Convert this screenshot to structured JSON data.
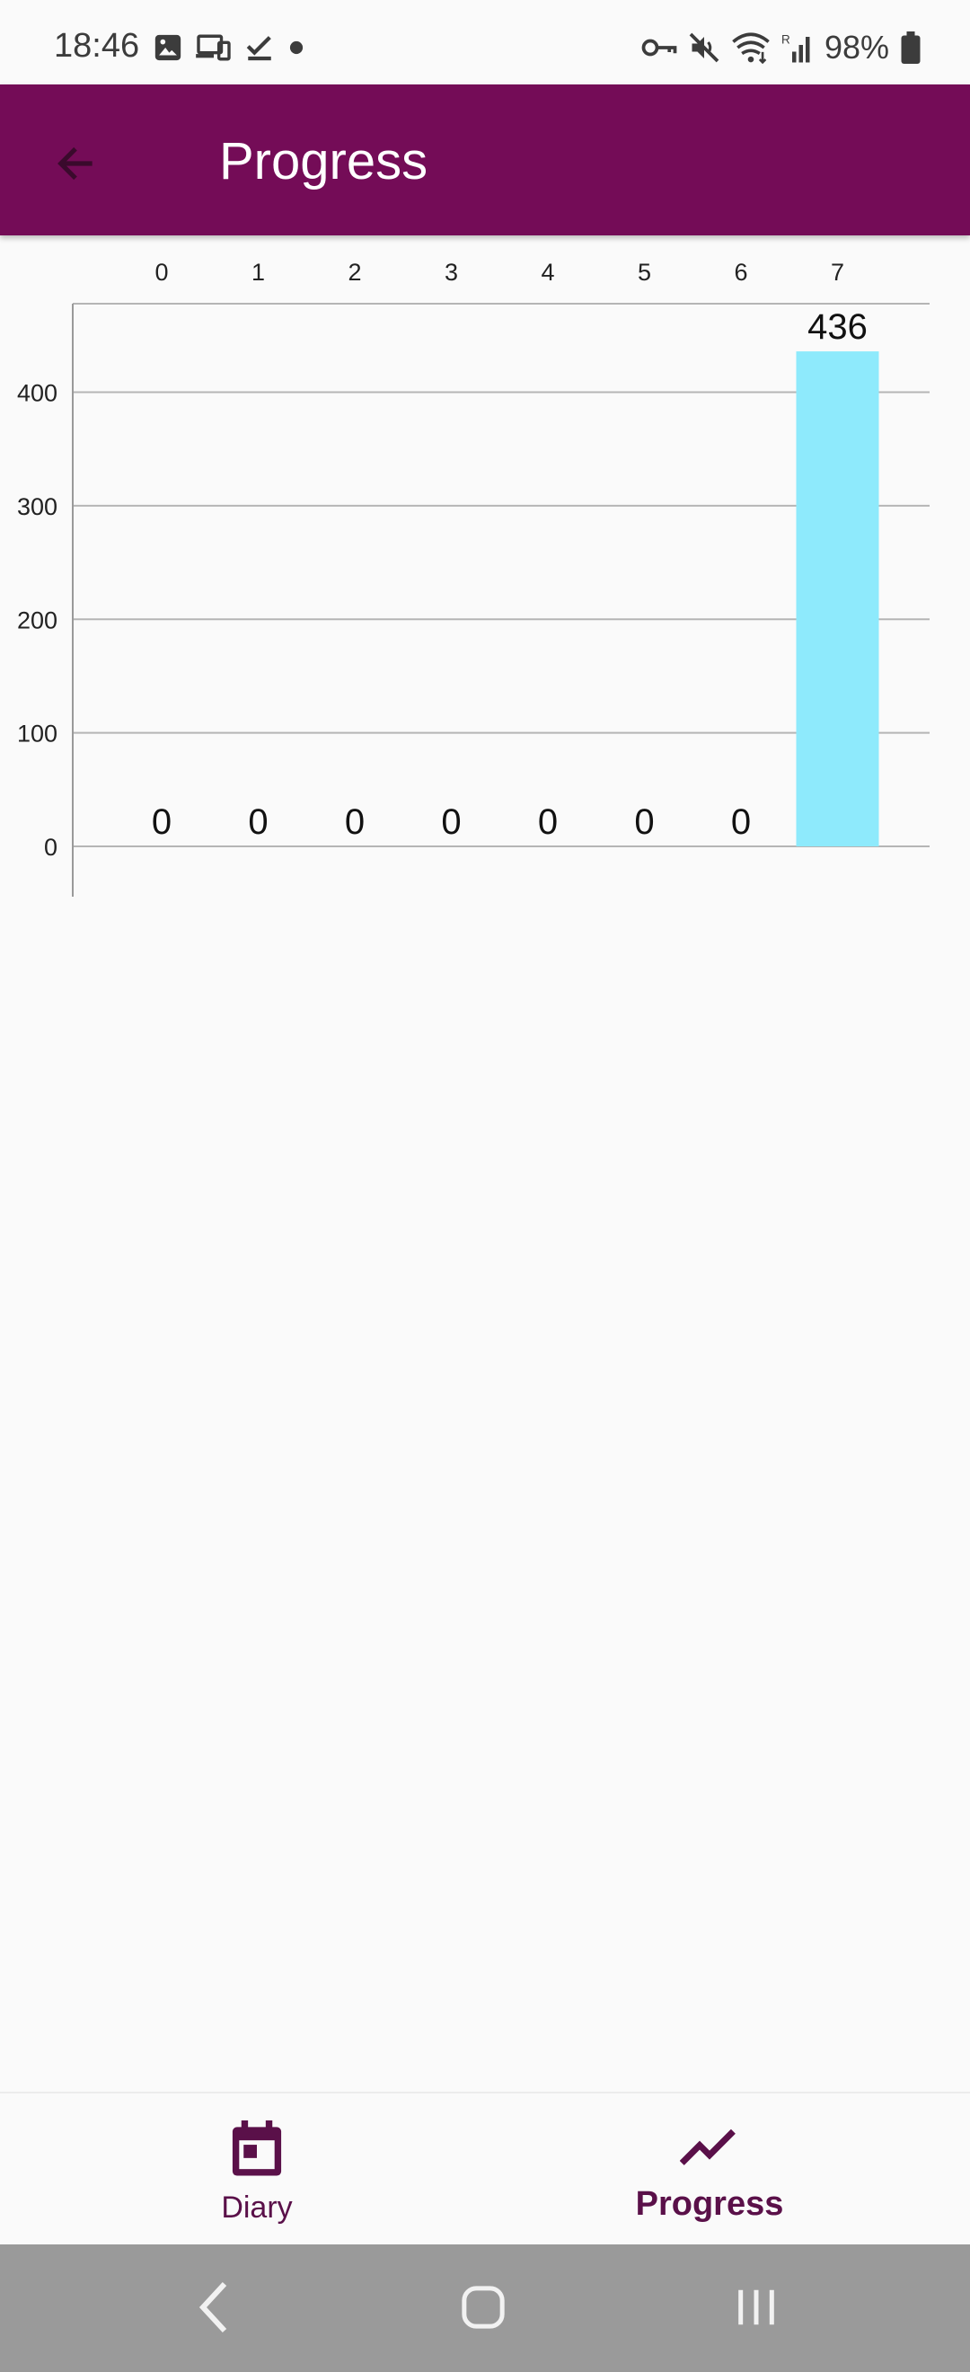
{
  "status_bar": {
    "time": "18:46",
    "battery": "98%"
  },
  "app_bar": {
    "title": "Progress"
  },
  "chart_data": {
    "type": "bar",
    "categories": [
      "0",
      "1",
      "2",
      "3",
      "4",
      "5",
      "6",
      "7"
    ],
    "values": [
      0,
      0,
      0,
      0,
      0,
      0,
      0,
      436
    ],
    "data_labels": [
      "0",
      "0",
      "0",
      "0",
      "0",
      "0",
      "0",
      "436"
    ],
    "y_ticks": [
      "0",
      "100",
      "200",
      "300",
      "400"
    ],
    "ylim": [
      0,
      478
    ],
    "x_axis_position": "top",
    "grid": true,
    "bar_color": "#8eeafc"
  },
  "bottom_nav": {
    "items": [
      {
        "label": "Diary",
        "icon": "calendar-icon",
        "active": false
      },
      {
        "label": "Progress",
        "icon": "trending-up-icon",
        "active": true
      }
    ]
  },
  "colors": {
    "primary": "#740c57",
    "nav_accent": "#5a1049",
    "background": "#fafafa"
  }
}
